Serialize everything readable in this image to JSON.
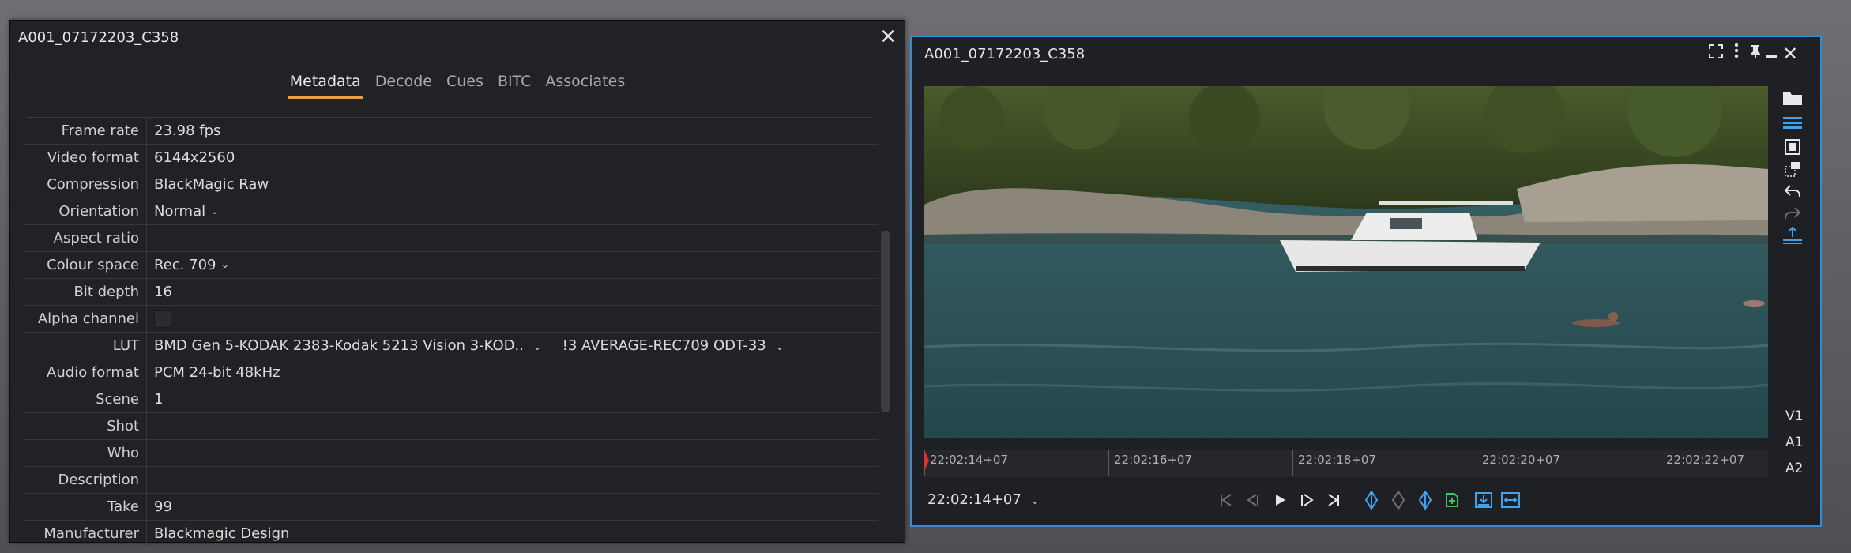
{
  "metadata_panel": {
    "title": "A001_07172203_C358",
    "tabs": [
      {
        "label": "Metadata",
        "active": true
      },
      {
        "label": "Decode",
        "active": false
      },
      {
        "label": "Cues",
        "active": false
      },
      {
        "label": "BITC",
        "active": false
      },
      {
        "label": "Associates",
        "active": false
      }
    ],
    "rows": [
      {
        "label": "Frame rate",
        "value": "23.98 fps"
      },
      {
        "label": "Video format",
        "value": "6144x2560"
      },
      {
        "label": "Compression",
        "value": "BlackMagic Raw"
      },
      {
        "label": "Orientation",
        "value": "Normal"
      },
      {
        "label": "Aspect ratio",
        "value": ""
      },
      {
        "label": "Colour space",
        "value": "Rec. 709"
      },
      {
        "label": "Bit depth",
        "value": "16"
      },
      {
        "label": "Alpha channel",
        "value": ""
      },
      {
        "label": "LUT",
        "value": "BMD Gen 5-KODAK 2383-Kodak 5213 Vision 3-KOD..",
        "value2": "!3 AVERAGE-REC709 ODT-33"
      },
      {
        "label": "Audio format",
        "value": "PCM 24-bit 48kHz"
      },
      {
        "label": "Scene",
        "value": "1"
      },
      {
        "label": "Shot",
        "value": ""
      },
      {
        "label": "Who",
        "value": ""
      },
      {
        "label": "Description",
        "value": ""
      },
      {
        "label": "Take",
        "value": "99"
      },
      {
        "label": "Manufacturer",
        "value": "Blackmagic Design"
      }
    ]
  },
  "viewer_panel": {
    "title": "A001_07172203_C358",
    "timeline_ticks": [
      "22:02:14+07",
      "22:02:16+07",
      "22:02:18+07",
      "22:02:20+07",
      "22:02:22+07"
    ],
    "current_timecode": "22:02:14+07",
    "tracks": [
      "V1",
      "A1",
      "A2"
    ]
  },
  "colors": {
    "accent_tab": "#e2a04a",
    "panel_focus_border": "#2e8fd9",
    "mark_icons": "#3fa3f0",
    "add_icon": "#3ec36a",
    "playhead": "#e0302a"
  }
}
